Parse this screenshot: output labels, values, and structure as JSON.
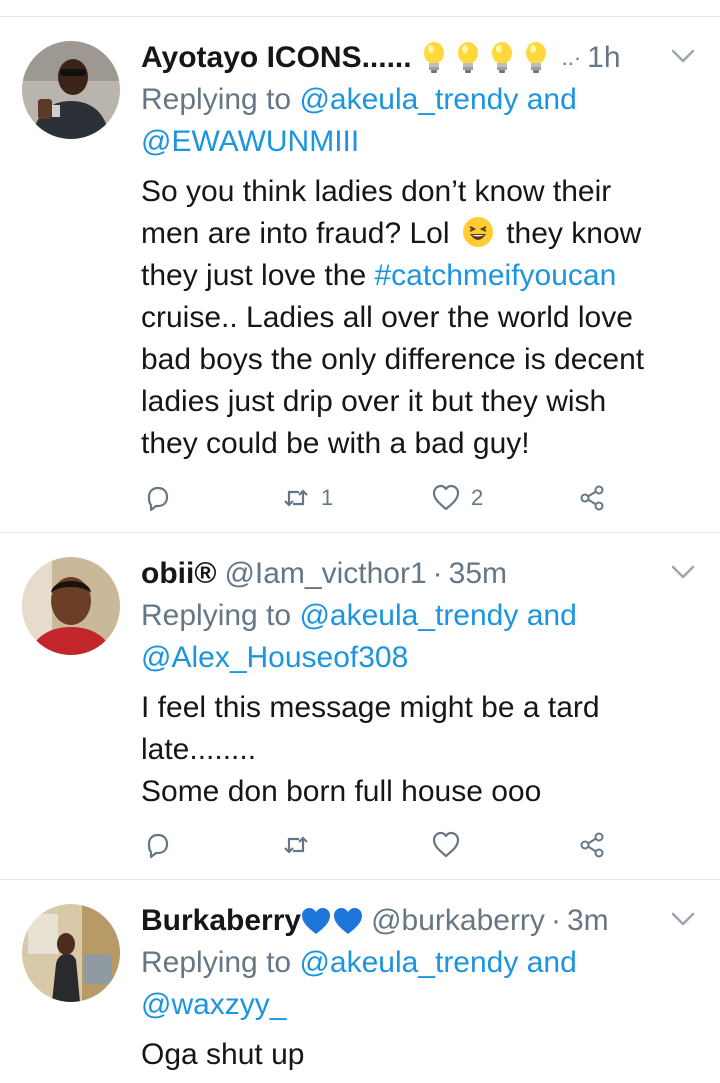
{
  "tweets": [
    {
      "name": "Ayotayo ICONS......",
      "emoji_count": 4,
      "overflow_mark": "..·",
      "time": "1h",
      "reply_prefix": "Replying to",
      "reply_user1": "@akeula_trendy",
      "reply_and": "and",
      "reply_user2": "@EWAWUNMIII",
      "body_line1": "So you think ladies don’t know their",
      "body_line2a": "men are into fraud? Lol",
      "body_line2b": "they know",
      "body_line3a": "they just love the",
      "body_line3_hashtag": "#catchmeifyoucan",
      "body_line4": "cruise.. Ladies all over the world love",
      "body_line5": "bad boys the only difference is decent",
      "body_line6": "ladies just drip over it but they wish",
      "body_line7": "they could be with a bad guy!",
      "retweets": "1",
      "likes": "2"
    },
    {
      "name": "obii®",
      "handle": "@Iam_victhor1",
      "sep": "·",
      "time": "35m",
      "reply_prefix": "Replying to",
      "reply_user1": "@akeula_trendy",
      "reply_and": "and",
      "reply_user2": "@Alex_Houseof308",
      "body_line1": "I feel this message might be a tard",
      "body_line2": "late........",
      "body_line3": "Some don born full house ooo",
      "retweets": "",
      "likes": ""
    },
    {
      "name": "Burkaberry",
      "handle": "@burkaberry",
      "sep": "·",
      "time": "3m",
      "reply_prefix": "Replying to",
      "reply_user1": "@akeula_trendy",
      "reply_and": "and",
      "reply_user2": "@waxzyy_",
      "body_line1": "Oga shut up"
    }
  ],
  "colors": {
    "link": "#1b95e0",
    "muted": "#657786",
    "text": "#14171a",
    "divider": "#e1e8ed",
    "heart_emoji": "#1d74d9"
  },
  "icons": [
    "reply-icon",
    "retweet-icon",
    "like-icon",
    "share-icon",
    "chevron-down-icon",
    "lightbulb-emoji",
    "laughing-emoji",
    "blue-heart-emoji"
  ]
}
